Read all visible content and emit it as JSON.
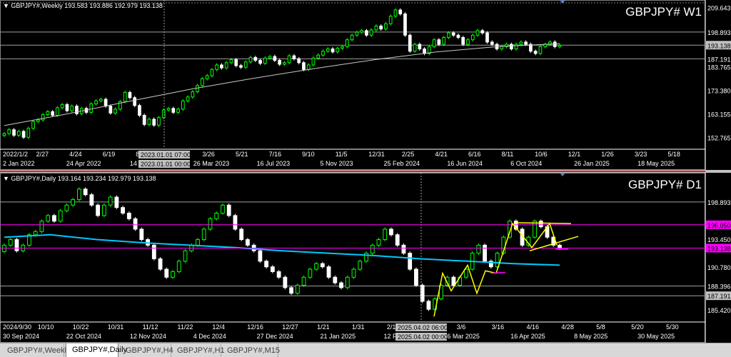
{
  "colors": {
    "background": "#000000",
    "bull_candle": "#00ff00",
    "bear_candle": "#ffffff",
    "grid": "#404040",
    "axis": "#ffffff",
    "ma_weekly": "#c8c8c8",
    "ma_daily": "#00c8ff",
    "magenta_line": "#ff00ff",
    "trend_yellow": "#ffff00",
    "separator_red": "#e02020"
  },
  "weekly": {
    "info": "GBPJPY#,Weekly  193.583 193.886 192.979 193.138",
    "symbol_label": "GBPJPY#  W1",
    "price_labels": [
      "209.643",
      "198.893",
      "193.138",
      "187.191",
      "183.765",
      "173.380",
      "163.155",
      "152.765"
    ],
    "date_labels": [
      "2022/1/2",
      "2/27",
      "4/24",
      "6/19",
      "8/14",
      "10/9",
      "3/26",
      "5/21",
      "7/16",
      "9/10",
      "11/5",
      "12/31",
      "2/25",
      "4/21",
      "6/16",
      "8/11",
      "10/6",
      "12/1",
      "1/26",
      "3/23",
      "5/18"
    ],
    "date_labels2": [
      "2 Jan 2022",
      "24 Apr 2022",
      "14 Aug 2022",
      "26 Mar 2023",
      "16 Jul 2023",
      "5 Nov 2023",
      "25 Feb 2024",
      "16 Jun 2024",
      "6 Oct 2024",
      "26 Jan 2025",
      "18 May 2025"
    ],
    "crosshair_date_top": "2023.01.01 07:00",
    "crosshair_date_bottom": "2023.01.01 00:00"
  },
  "daily": {
    "info": "GBPJPY#,Daily  193.164 193.234 192.979 193.138",
    "symbol_label": "GBPJPY#  D1",
    "price_labels": [
      "198.893",
      "193.138",
      "190.780",
      "188.396",
      "187.191",
      "185.420"
    ],
    "magenta_labels": [
      "196.050",
      "193.138"
    ],
    "hidden_label": "193.450",
    "date_labels": [
      "2024/9/30",
      "10/10",
      "10/22",
      "10/31",
      "11/12",
      "11/22",
      "12/4",
      "12/16",
      "12/27",
      "1/21",
      "1/31",
      "2/12",
      "2/24",
      "3/6",
      "3/16",
      "4/16",
      "4/28",
      "5/8",
      "5/20",
      "5/30"
    ],
    "date_labels2": [
      "30 Sep 2024",
      "22 Oct 2024",
      "12 Nov 2024",
      "4 Dec 2024",
      "27 Dec 2024",
      "21 Jan 2025",
      "12 Feb 2025",
      "6 Mar 2025",
      "16 Apr 2025",
      "8 May 2025",
      "30 May 2025"
    ],
    "crosshair_date_top": "2025.04.02 06:00",
    "crosshair_date_bottom": "2025.04.02 00:00"
  },
  "tabs": [
    "GBPJPY#,Weekly",
    "GBPJPY#,Daily",
    "GBPJPY#,H4",
    "GBPJPY#,H1",
    "GBPJPY#,M15"
  ],
  "active_tab": "GBPJPY#,Daily",
  "chart_data": [
    {
      "type": "candlestick",
      "title": "GBPJPY#  W1",
      "ylim": [
        148.0,
        211.0
      ],
      "series": [
        {
          "name": "close",
          "values": [
            154.5,
            156.2,
            153.8,
            155.5,
            152.9,
            156.8,
            159.8,
            160.5,
            162.8,
            164.1,
            162.5,
            165.8,
            167.2,
            164.5,
            166.5,
            163.2,
            165.5,
            163.8,
            167.5,
            168.8,
            169.5,
            166.5,
            163.5,
            165.2,
            168.5,
            172.5,
            170.2,
            166.8,
            162.5,
            158.5,
            160.8,
            158.2,
            161.5,
            164.8,
            165.5,
            163.8,
            165.2,
            168.8,
            170.5,
            172.8,
            175.5,
            178.5,
            179.8,
            182.5,
            184.5,
            183.2,
            185.5,
            186.8,
            184.2,
            183.5,
            185.8,
            187.8,
            186.5,
            185.2,
            187.5,
            188.2,
            186.5,
            184.8,
            185.5,
            188.5,
            187.2,
            185.5,
            182.5,
            184.5,
            187.5,
            188.8,
            190.5,
            191.5,
            190.2,
            191.8,
            192.5,
            195.5,
            197.5,
            198.8,
            199.5,
            197.5,
            199.8,
            201.5,
            200.2,
            202.5,
            205.8,
            208.5,
            206.8,
            197.5,
            190.5,
            193.5,
            191.5,
            189.5,
            192.5,
            195.5,
            193.5,
            196.5,
            198.5,
            197.5,
            196.5,
            193.5,
            195.5,
            197.5,
            199.5,
            198.5,
            194.5,
            193.5,
            191.5,
            192.5,
            193.5,
            191.5,
            193.5,
            194.5,
            193.5,
            190.5,
            189.5,
            192.5,
            193.5,
            194.5,
            192.5,
            193.1
          ]
        },
        {
          "name": "ma",
          "values": [
            158.0,
            163.0,
            168.5,
            173.8,
            178.5,
            182.8,
            186.8,
            190.2,
            192.5,
            193.8
          ]
        }
      ]
    },
    {
      "type": "candlestick",
      "title": "GBPJPY#  D1",
      "ylim": [
        184.0,
        202.0
      ],
      "series": [
        {
          "name": "close",
          "values": [
            193.5,
            194.2,
            192.8,
            193.5,
            194.8,
            195.2,
            196.5,
            197.2,
            196.5,
            197.8,
            198.5,
            199.2,
            200.5,
            199.8,
            198.5,
            197.2,
            198.5,
            199.5,
            198.2,
            197.5,
            196.8,
            195.5,
            194.2,
            193.5,
            191.8,
            190.5,
            189.5,
            190.2,
            191.5,
            192.8,
            193.5,
            194.2,
            195.5,
            196.8,
            197.5,
            198.5,
            197.2,
            195.5,
            194.2,
            193.5,
            192.8,
            191.5,
            190.8,
            190.2,
            189.5,
            188.2,
            187.5,
            188.5,
            189.5,
            190.5,
            191.2,
            190.8,
            189.5,
            188.8,
            188.2,
            189.5,
            190.5,
            191.5,
            192.5,
            193.5,
            194.2,
            195.5,
            194.8,
            193.5,
            192.5,
            190.5,
            188.5,
            186.5,
            185.5,
            186.8,
            188.5,
            189.5,
            188.5,
            189.5,
            190.5,
            192.5,
            193.5,
            191.5,
            190.8,
            192.5,
            194.5,
            196.5,
            195.5,
            193.5,
            194.5,
            196.5,
            195.8,
            194.5,
            193.5,
            193.1
          ]
        },
        {
          "name": "ma",
          "values": [
            194.5,
            194.8,
            194.2,
            193.8,
            193.5,
            193.2,
            192.8,
            192.5,
            192.2,
            191.8,
            191.5,
            191.2,
            191.0
          ]
        }
      ],
      "levels": [
        196.05,
        193.138
      ]
    }
  ]
}
